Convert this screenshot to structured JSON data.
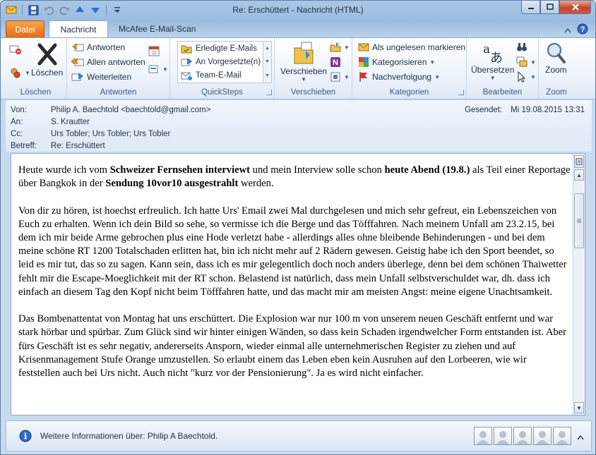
{
  "window": {
    "title": "Re: Erschüttert  -  Nachricht (HTML)"
  },
  "tabs": [
    {
      "label": "Datei"
    },
    {
      "label": "Nachricht"
    },
    {
      "label": "McAfee E-Mail-Scan"
    }
  ],
  "ribbon": {
    "groups": {
      "loeschen": "Löschen",
      "antworten": "Antworten",
      "quicksteps": "QuickSteps",
      "verschieben": "Verschieben",
      "kategorien": "Kategorien",
      "bearbeiten": "Bearbeiten",
      "zoom": "Zoom"
    },
    "delete_label": "Löschen",
    "reply": "Antworten",
    "reply_all": "Allen antworten",
    "forward": "Weiterleiten",
    "quicksteps": [
      "Erledigte E-Mails",
      "An Vorgesetzte(n)",
      "Team-E-Mail"
    ],
    "move_label": "Verschieben",
    "mark_unread": "Als ungelesen markieren",
    "categorize": "Kategorisieren",
    "followup": "Nachverfolgung",
    "translate": "Übersetzen",
    "zoom_label": "Zoom"
  },
  "header": {
    "from_label": "Von:",
    "from": "Philip A. Baechtold <baechtold@gmail.com>",
    "to_label": "An:",
    "to": "S. Krautter",
    "cc_label": "Cc:",
    "cc": "Urs Tobler; Urs Tobler; Urs Tobler",
    "subject_label": "Betreff:",
    "subject": "Re: Erschüttert",
    "sent_label": "Gesendet:",
    "sent": "Mi 19.08.2015 13:31"
  },
  "body": {
    "p1": [
      {
        "t": "Heute wurde ich vom ",
        "b": false
      },
      {
        "t": "Schweizer Fernsehen interviewt",
        "b": true
      },
      {
        "t": " und mein Interview solle schon ",
        "b": false
      },
      {
        "t": "heute Abend (19.8.)",
        "b": true
      },
      {
        "t": " als Teil einer Reportage über Bangkok in der ",
        "b": false
      },
      {
        "t": "Sendung 10vor10 ausgestrahlt",
        "b": true
      },
      {
        "t": " werden.",
        "b": false
      }
    ],
    "p2": "Von dir zu hören, ist hoechst erfreulich. Ich hatte Urs' Email zwei Mal durchgelesen und mich sehr gefreut, ein Lebenszeichen von Euch zu erhalten. Wenn ich dein Bild so sehe, so vermisse ich die Berge und das Töfffahren. Nach meinem Unfall am 23.2.15, bei dem ich mir beide Arme gebrochen plus eine Hode verletzt habe - allerdings alles ohne bleibende Behinderungen - und bei dem meine schöne RT 1200 Totalschaden erlitten hat, bin ich nicht mehr auf 2 Rädern gewesen. Geistig habe ich den Sport beendet, so leid es mir tut, das so zu sagen. Kann sein, dass ich es mir gelegentlich doch noch anders überlege, denn bei dem schönen Thaiwetter fehlt mir die Escape-Moeglichkeit mit der RT schon. Belastend ist natürlich, dass mein Unfall selbstverschuldet war, dh. dass ich einfach an diesem Tag den Kopf nicht beim Töfffahren hatte, und das macht mir am meisten Angst: meine eigene Unachtsamkeit.",
    "p3": "Das Bombenattentat von Montag hat uns erschüttert. Die Explosion war nur 100 m von unserem neuen Geschäft entfernt und war stark hörbar und spürbar. Zum Glück sind wir hinter einigen Wänden, so dass kein Schaden irgendwelcher Form entstanden ist. Aber fürs Geschäft ist es sehr negativ, andererseits Ansporn, wieder einmal alle unternehmerischen Register zu ziehen und auf Krisenmanagement Stufe Orange umzustellen. So erlaubt einem das Leben eben kein Ausruhen auf den Lorbeeren, wie wir feststellen auch bei Urs nicht. Auch nicht \"kurz vor der Pensionierung\". Ja es wird nicht einfacher."
  },
  "people_pane": {
    "text": "Weitere Informationen über: Philip A Baechtold."
  },
  "colors": {
    "file_tab": "#e66a12",
    "accent": "#1e395b",
    "close": "#c4452f"
  }
}
